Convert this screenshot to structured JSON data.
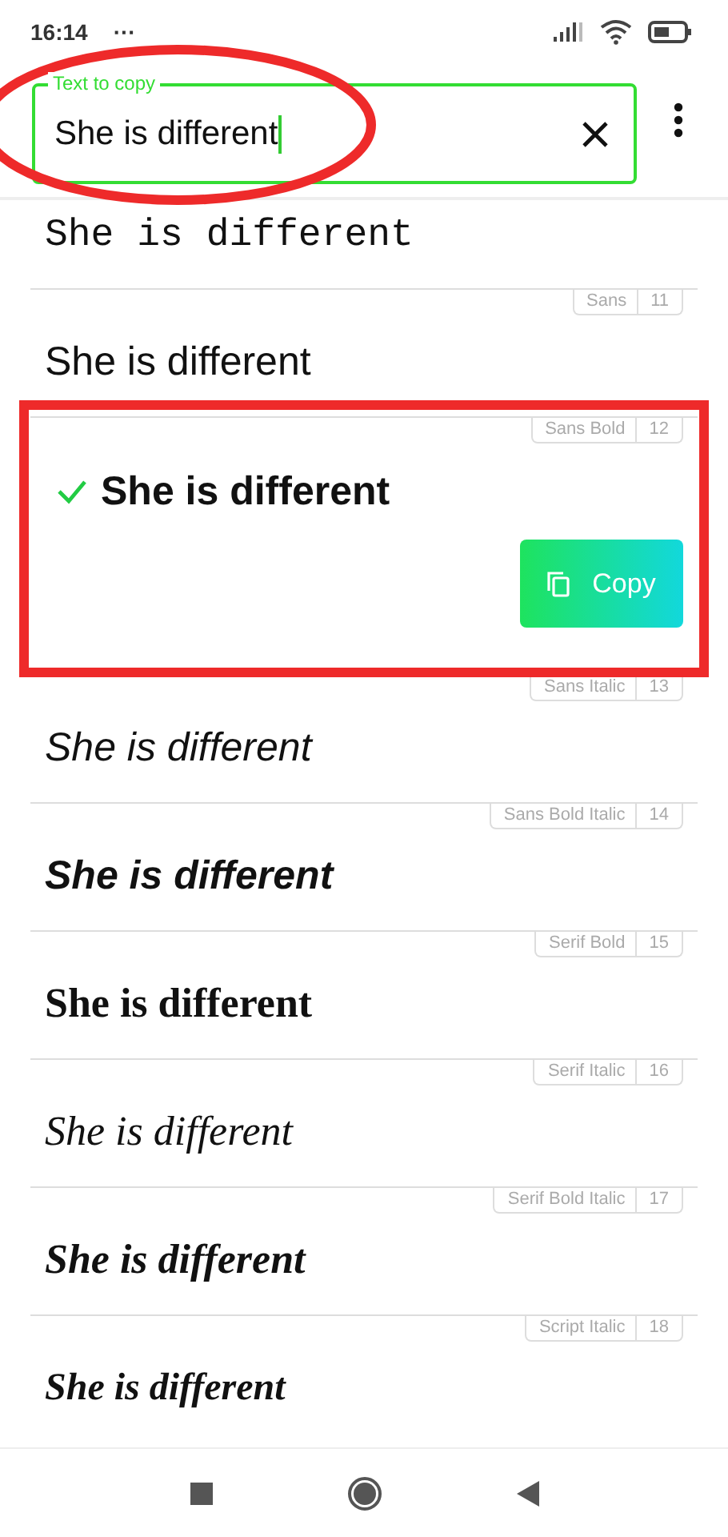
{
  "status_bar": {
    "time": "16:14",
    "more": "···"
  },
  "text_field": {
    "label": "Text to copy",
    "value": "She is different",
    "focused": true
  },
  "copy_button": {
    "label": "Copy"
  },
  "styles": [
    {
      "kind": "mono",
      "sample": "She is different",
      "selected": false
    },
    {
      "kind": "sans",
      "sample": "She is different",
      "selected": false,
      "tag": "Sans",
      "number": "11"
    },
    {
      "kind": "sansbold",
      "sample": "She is different",
      "selected": true,
      "tag": "Sans Bold",
      "number": "12"
    },
    {
      "kind": "sansitalic",
      "sample": "She is different",
      "selected": false,
      "tag": "Sans Italic",
      "number": "13"
    },
    {
      "kind": "sansbolditalic",
      "sample": "She is different",
      "selected": false,
      "tag": "Sans Bold Italic",
      "number": "14"
    },
    {
      "kind": "serifbold",
      "sample": "She is different",
      "selected": false,
      "tag": "Serif Bold",
      "number": "15"
    },
    {
      "kind": "serifitalic",
      "sample": "She is different",
      "selected": false,
      "tag": "Serif Italic",
      "number": "16"
    },
    {
      "kind": "serifbolditalic",
      "sample": "She is different",
      "selected": false,
      "tag": "Serif Bold Italic",
      "number": "17"
    },
    {
      "kind": "script",
      "sample": "She is different",
      "selected": false,
      "tag": "Script Italic",
      "number": "18"
    }
  ]
}
